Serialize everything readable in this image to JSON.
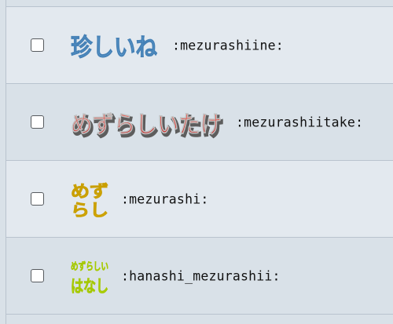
{
  "emoji_list": {
    "rows": [
      {
        "checked": false,
        "emoji_text": "珍しいね",
        "shortcode": ":mezurashiine:",
        "emoji_color": "#5b9bcf"
      },
      {
        "checked": false,
        "emoji_text": "めずらしいたけ",
        "shortcode": ":mezurashiitake:",
        "emoji_color": "#e03a35"
      },
      {
        "checked": false,
        "emoji_text_line1": "めず",
        "emoji_text_line2": "らし",
        "shortcode": ":mezurashi:",
        "emoji_color": "#f2c200"
      },
      {
        "checked": false,
        "emoji_text_line1": "めずらしい",
        "emoji_text_line2": "はなし",
        "shortcode": ":hanashi_mezurashii:",
        "emoji_color": "#c8f000"
      }
    ]
  }
}
